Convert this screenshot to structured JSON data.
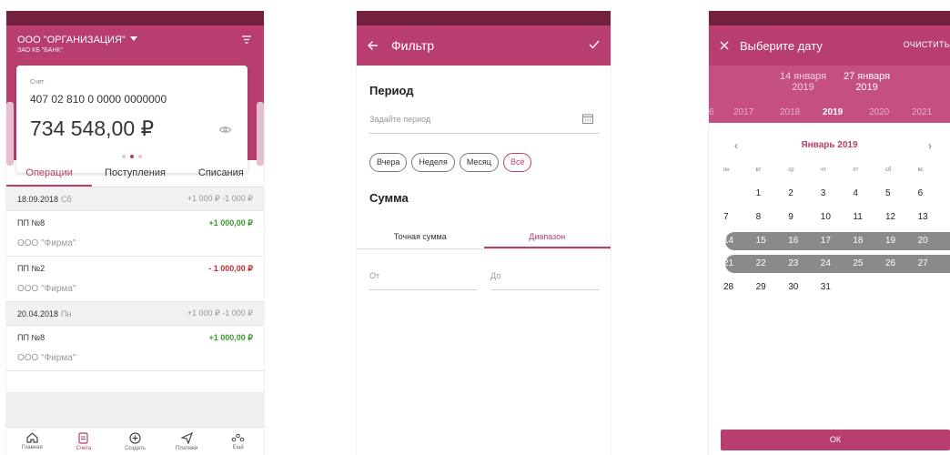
{
  "colors": {
    "accent": "#b73e6f",
    "status_bar": "#73203f",
    "positive": "#3a9a2c",
    "negative": "#c02c2c"
  },
  "accounts_screen": {
    "org_name": "ООО \"ОРГАНИЗАЦИЯ\"",
    "bank_name": "ЗАО КБ \"БАНК\"",
    "card": {
      "label": "Счет",
      "number": "407 02 810 0 0000 0000000",
      "balance": "734 548,00 ₽"
    },
    "tabs": [
      "Операции",
      "Поступления",
      "Списания"
    ],
    "groups": [
      {
        "date": "18.09.2018",
        "weekday": "Сб",
        "sums": "+1 000 ₽  -1 000 ₽",
        "ops": [
          {
            "name": "ПП №8",
            "counterparty": "ООО \"Фирма\"",
            "amount": "+1 000,00 ₽",
            "positive": true
          },
          {
            "name": "ПП №2",
            "counterparty": "ООО \"Фирма\"",
            "amount": "- 1 000,00 ₽",
            "positive": false
          }
        ]
      },
      {
        "date": "20.04.2018",
        "weekday": "Пн",
        "sums": "+1 000 ₽  -1 000 ₽",
        "ops": [
          {
            "name": "ПП №8",
            "counterparty": "ООО \"Фирма\"",
            "amount": "+1 000,00 ₽",
            "positive": true
          }
        ]
      }
    ],
    "bottom_nav": [
      {
        "label": "Главная",
        "icon": "home-icon"
      },
      {
        "label": "Счета",
        "icon": "document-icon",
        "active": true
      },
      {
        "label": "Создать",
        "icon": "plus-circle-icon"
      },
      {
        "label": "Платежи",
        "icon": "send-icon"
      },
      {
        "label": "Ещё",
        "icon": "more-icon"
      }
    ]
  },
  "filter_screen": {
    "title": "Фильтр",
    "period_heading": "Период",
    "period_placeholder": "Задайте период",
    "chips": [
      "Вчера",
      "Неделя",
      "Месяц",
      "Всё"
    ],
    "selected_chip": "Всё",
    "amount_heading": "Сумма",
    "amount_tabs": [
      "Точная сумма",
      "Диапазон"
    ],
    "active_amount_tab": "Диапазон",
    "from_placeholder": "От",
    "to_placeholder": "До"
  },
  "date_screen": {
    "title": "Выберите дату",
    "clear_label": "ОЧИСТИТЬ",
    "range_start": {
      "day": "14 января",
      "year": "2019"
    },
    "range_end": {
      "day": "27 января",
      "year": "2019"
    },
    "years": [
      "6",
      "2017",
      "2018",
      "2019",
      "2020",
      "2021"
    ],
    "current_year": "2019",
    "month": "Январь 2019",
    "weekdays": [
      "пн",
      "вт",
      "ср",
      "чт",
      "пт",
      "сб",
      "вс"
    ],
    "weeks": [
      [
        "",
        "1",
        "2",
        "3",
        "4",
        "5",
        "6"
      ],
      [
        "7",
        "8",
        "9",
        "10",
        "11",
        "12",
        "13"
      ],
      [
        "14",
        "15",
        "16",
        "17",
        "18",
        "19",
        "20"
      ],
      [
        "21",
        "22",
        "23",
        "24",
        "25",
        "26",
        "27"
      ],
      [
        "28",
        "29",
        "30",
        "31",
        "",
        "",
        ""
      ]
    ],
    "ok_label": "ОК"
  }
}
